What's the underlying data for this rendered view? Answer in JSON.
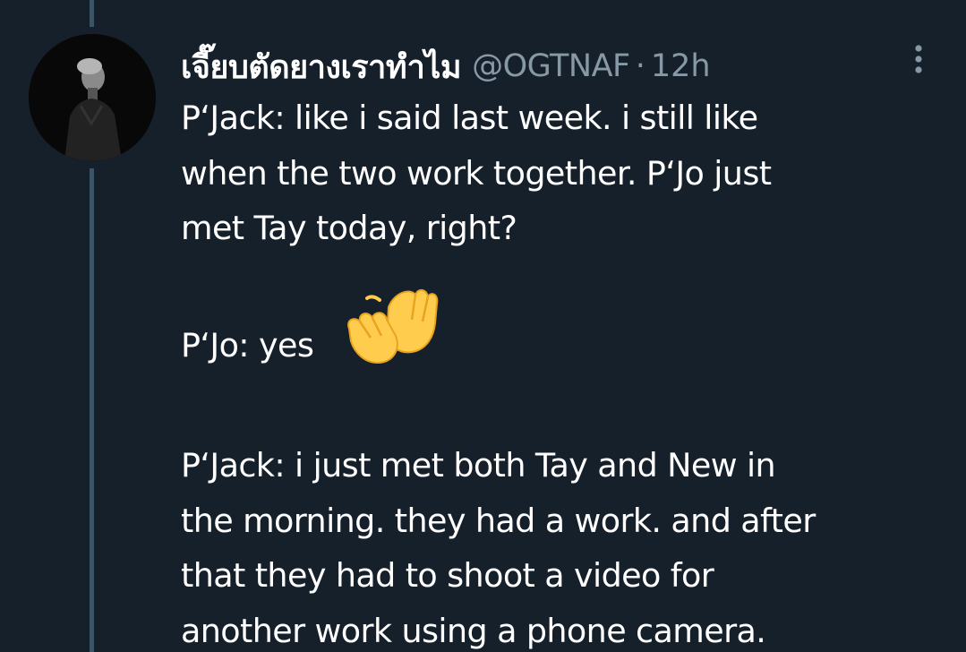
{
  "tweet": {
    "display_name": "เจี๊ยบตัดยางเราทำไม",
    "handle": "@OGTNAF",
    "separator": "·",
    "timestamp": "12h",
    "more_icon": "more-vertical-icon",
    "avatar_icon": "user-avatar",
    "lines": {
      "p1_l1": "P‘Jack: like i said last week. i still like",
      "p1_l2": "when the two work together. P‘Jo just",
      "p1_l3": "met Tay today, right?",
      "p2_l1": "P‘Jo: yes",
      "p3_l1": "P‘Jack: i just met both Tay and New in",
      "p3_l2": "the morning. they had a work. and after",
      "p3_l3": "that they had to shoot a video for",
      "p3_l4": "another work using a phone camera."
    },
    "emoji": "waving-hands-emoji"
  },
  "colors": {
    "background": "#15202b",
    "secondary_text": "#8899a6",
    "thread_line": "#3d5466",
    "emoji_yellow": "#ffcc4d"
  }
}
